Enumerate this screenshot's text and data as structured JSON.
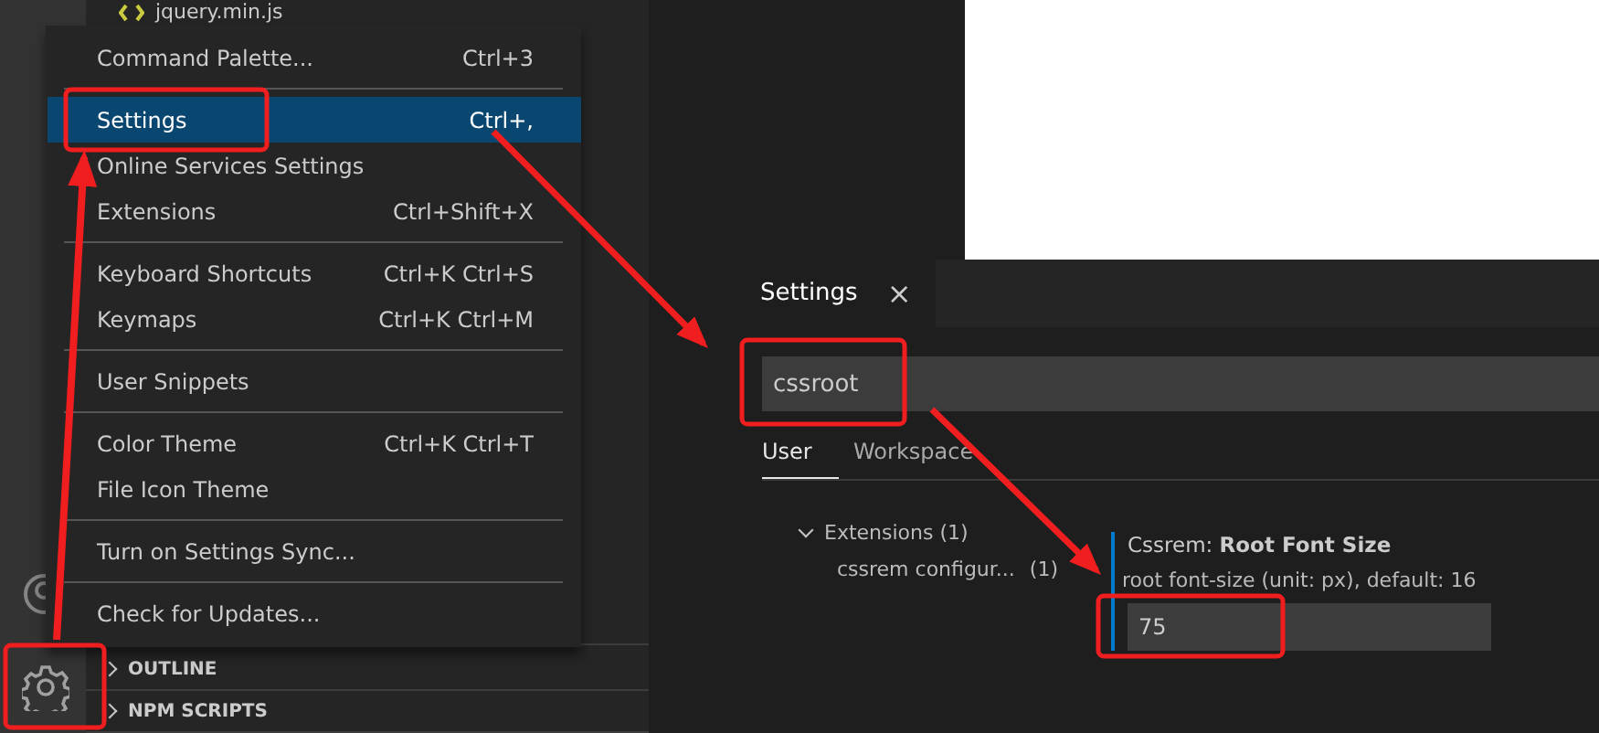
{
  "explorer": {
    "file": "jquery.min.js"
  },
  "menu": {
    "items": [
      {
        "kind": "item",
        "label": "Command Palette...",
        "shortcut": "Ctrl+3",
        "selected": false
      },
      {
        "kind": "separator"
      },
      {
        "kind": "item",
        "label": "Settings",
        "shortcut": "Ctrl+,",
        "selected": true
      },
      {
        "kind": "item",
        "label": "Online Services Settings",
        "selected": false
      },
      {
        "kind": "item",
        "label": "Extensions",
        "shortcut": "Ctrl+Shift+X",
        "selected": false
      },
      {
        "kind": "separator"
      },
      {
        "kind": "item",
        "label": "Keyboard Shortcuts",
        "shortcut": "Ctrl+K Ctrl+S",
        "selected": false
      },
      {
        "kind": "item",
        "label": "Keymaps",
        "shortcut": "Ctrl+K Ctrl+M",
        "selected": false
      },
      {
        "kind": "separator"
      },
      {
        "kind": "item",
        "label": "User Snippets",
        "selected": false
      },
      {
        "kind": "separator"
      },
      {
        "kind": "item",
        "label": "Color Theme",
        "shortcut": "Ctrl+K Ctrl+T",
        "selected": false
      },
      {
        "kind": "item",
        "label": "File Icon Theme",
        "selected": false
      },
      {
        "kind": "separator"
      },
      {
        "kind": "item",
        "label": "Turn on Settings Sync...",
        "selected": false
      },
      {
        "kind": "separator"
      },
      {
        "kind": "item",
        "label": "Check for Updates...",
        "selected": false
      }
    ]
  },
  "sidebar_sections": [
    {
      "label": "OUTLINE",
      "expanded": false
    },
    {
      "label": "NPM SCRIPTS",
      "expanded": false
    }
  ],
  "settings": {
    "tab": {
      "title": "Settings",
      "close": "×"
    },
    "search": {
      "value": "cssroot"
    },
    "scope_tabs": [
      {
        "label": "User",
        "selected": true
      },
      {
        "label": "Workspace",
        "selected": false
      }
    ],
    "toc": [
      {
        "label": "Extensions (1)",
        "expanded": true,
        "children": [
          {
            "label": "cssrem configur...",
            "count": "(1)"
          }
        ]
      }
    ],
    "setting": {
      "category": "Cssrem: ",
      "name": "Root Font Size",
      "description": "root font-size (unit: px), default: 16",
      "value": "75"
    }
  }
}
